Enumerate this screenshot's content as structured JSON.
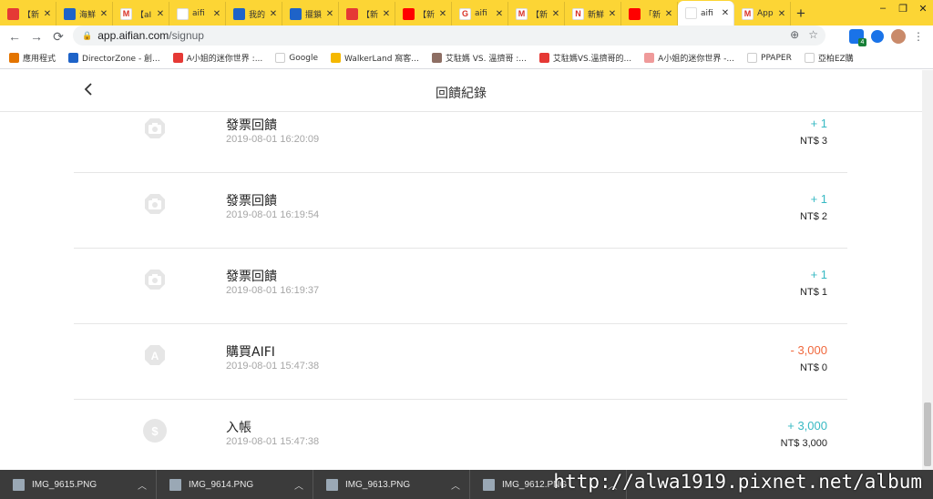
{
  "browser": {
    "tabs": [
      {
        "title": "【新",
        "fav_color": "#e53935",
        "fav_char": "",
        "active": false
      },
      {
        "title": "海鮮",
        "fav_color": "#1e63c8",
        "fav_char": "",
        "active": false
      },
      {
        "title": "【aI",
        "fav_color": "#ffffff",
        "fav_char": "M",
        "active": false
      },
      {
        "title": "aifi",
        "fav_color": "#ffffff",
        "fav_char": "",
        "active": false
      },
      {
        "title": "我的",
        "fav_color": "#1e63c8",
        "fav_char": "",
        "active": false
      },
      {
        "title": "擺鎖",
        "fav_color": "#1e63c8",
        "fav_char": "",
        "active": false
      },
      {
        "title": "【新",
        "fav_color": "#e53935",
        "fav_char": "",
        "active": false
      },
      {
        "title": "【新",
        "fav_color": "#ff0000",
        "fav_char": "",
        "active": false
      },
      {
        "title": "aifi",
        "fav_color": "#ffffff",
        "fav_char": "G",
        "active": false
      },
      {
        "title": "【新",
        "fav_color": "#ffffff",
        "fav_char": "M",
        "active": false
      },
      {
        "title": "新鮮",
        "fav_color": "#ffffff",
        "fav_char": "N",
        "active": false
      },
      {
        "title": "「新",
        "fav_color": "#ff0000",
        "fav_char": "",
        "active": false
      },
      {
        "title": "aifi",
        "fav_color": "#ffffff",
        "fav_char": "",
        "active": true
      },
      {
        "title": "App",
        "fav_color": "#ffffff",
        "fav_char": "M",
        "active": false
      }
    ],
    "close_glyph": "✕",
    "new_tab_glyph": "+",
    "url_host": "app.aifian.com",
    "url_path": "/signup",
    "bookmarks": [
      {
        "label": "應用程式",
        "color": "#e37400"
      },
      {
        "label": "DirectorZone - 創...",
        "color": "#1e63c8"
      },
      {
        "label": "A小姐的迷你世界 :...",
        "color": "#e53935"
      },
      {
        "label": "Google",
        "color": "#ffffff"
      },
      {
        "label": "WalkerLand 窩客...",
        "color": "#f5b800"
      },
      {
        "label": "艾駐媽 VS. 溫擠哥 :...",
        "color": "#8d6e63"
      },
      {
        "label": "艾駐媽VS.溫擠哥的...",
        "color": "#e53935"
      },
      {
        "label": "A小姐的迷你世界 -...",
        "color": "#ef9a9a"
      },
      {
        "label": "PPAPER",
        "color": "#ffffff"
      },
      {
        "label": "亞柏EZ購",
        "color": "#ffffff"
      }
    ]
  },
  "page": {
    "title": "回饋紀錄",
    "records": [
      {
        "title": "發票回饋",
        "time": "2019-08-01 16:20:09",
        "amount": "+ 1",
        "balance": "NT$ 3",
        "sign": "pos",
        "icon": "camera-icon"
      },
      {
        "title": "發票回饋",
        "time": "2019-08-01 16:19:54",
        "amount": "+ 1",
        "balance": "NT$ 2",
        "sign": "pos",
        "icon": "camera-icon"
      },
      {
        "title": "發票回饋",
        "time": "2019-08-01 16:19:37",
        "amount": "+ 1",
        "balance": "NT$ 1",
        "sign": "pos",
        "icon": "camera-icon"
      },
      {
        "title": "購買AIFI",
        "time": "2019-08-01 15:47:38",
        "amount": "- 3,000",
        "balance": "NT$ 0",
        "sign": "neg",
        "icon": "aifi-coin-icon"
      },
      {
        "title": "入帳",
        "time": "2019-08-01 15:47:38",
        "amount": "+ 3,000",
        "balance": "NT$ 3,000",
        "sign": "pos",
        "icon": "dollar-coin-icon"
      }
    ]
  },
  "downloads": [
    {
      "file": "IMG_9615.PNG"
    },
    {
      "file": "IMG_9614.PNG"
    },
    {
      "file": "IMG_9613.PNG"
    },
    {
      "file": "IMG_9612.PNG"
    }
  ],
  "watermark": "http://alwa1919.pixnet.net/album"
}
